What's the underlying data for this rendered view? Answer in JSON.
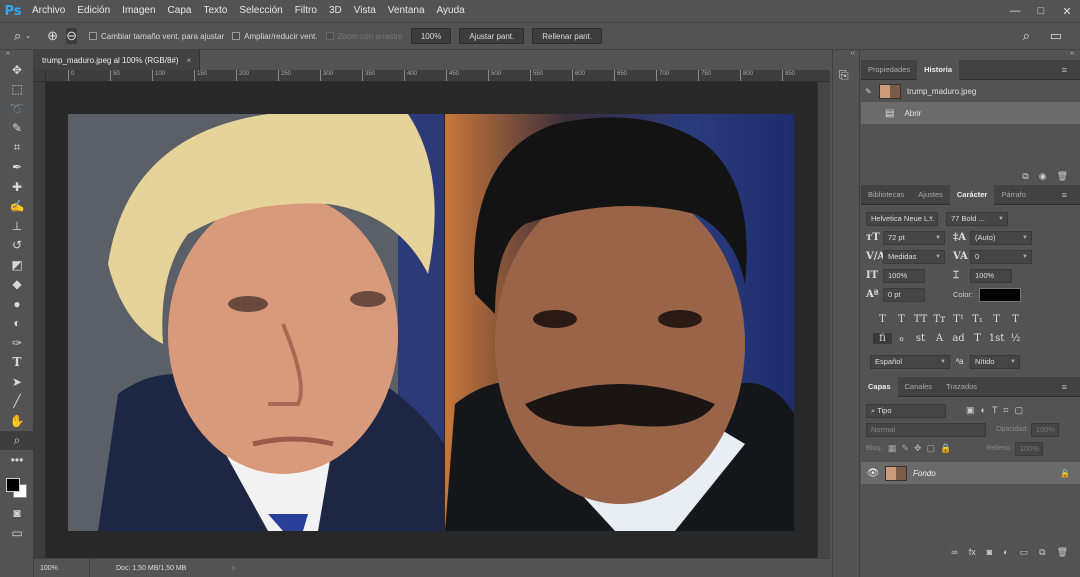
{
  "app": {
    "logo": "Ps"
  },
  "menu": [
    "Archivo",
    "Edición",
    "Imagen",
    "Capa",
    "Texto",
    "Selección",
    "Filtro",
    "3D",
    "Vista",
    "Ventana",
    "Ayuda"
  ],
  "window_controls": {
    "minimize": "—",
    "maximize": "□",
    "close": "✕"
  },
  "options": {
    "resize_windows": "Cambiar tamaño vent. para ajustar",
    "zoom_all": "Ampliar/reducir vent.",
    "scrubby_zoom": "Zoom con arrastre",
    "btn_100": "100%",
    "btn_fit": "Ajustar pant.",
    "btn_fill": "Rellenar pant."
  },
  "document": {
    "tab_title": "trump_maduro.jpeg al 100% (RGB/8#)",
    "close": "×",
    "ruler_ticks": [
      "0",
      "50",
      "100",
      "150",
      "200",
      "250",
      "300",
      "350",
      "400",
      "450",
      "500",
      "550",
      "600",
      "650",
      "700",
      "750",
      "800",
      "850"
    ]
  },
  "status": {
    "zoom": "100%",
    "doc": "Doc: 1,50 MB/1,50 MB",
    "arrow": "›"
  },
  "history_panel": {
    "tabs": [
      "Propiedades",
      "Historia"
    ],
    "active_tab": "Historia",
    "snapshot": "trump_maduro.jpeg",
    "steps": [
      "Abrir"
    ]
  },
  "character_panel": {
    "tabs": [
      "Bibliotecas",
      "Ajustes",
      "Carácter",
      "Párrafo"
    ],
    "active_tab": "Carácter",
    "font_family": "Helvetica Neue L...",
    "font_style": "77 Bold ...",
    "size": "72 pt",
    "leading": "(Auto)",
    "kerning": "Medidas",
    "tracking": "0",
    "vscale": "100%",
    "hscale": "100%",
    "baseline": "0 pt",
    "color_label": "Color:",
    "color": "#000000",
    "style_buttons": [
      "T",
      "T",
      "TT",
      "Tт",
      "T¹",
      "T₁",
      "T",
      "T"
    ],
    "opentype_buttons": [
      "fi",
      "ℴ",
      "st",
      "A",
      "ad",
      "T",
      "1st",
      "½"
    ],
    "language": "Español",
    "aa_label": "ªa",
    "antialias": "Nítido"
  },
  "layers_panel": {
    "tabs": [
      "Capas",
      "Canales",
      "Trazados"
    ],
    "active_tab": "Capas",
    "filter": "Tipo",
    "blend_mode": "Normal",
    "opacity_label": "Opacidad:",
    "opacity": "100%",
    "lock_label": "Bloq.:",
    "fill_label": "Relleno:",
    "fill": "100%",
    "layers": [
      {
        "name": "Fondo",
        "locked": true
      }
    ]
  }
}
